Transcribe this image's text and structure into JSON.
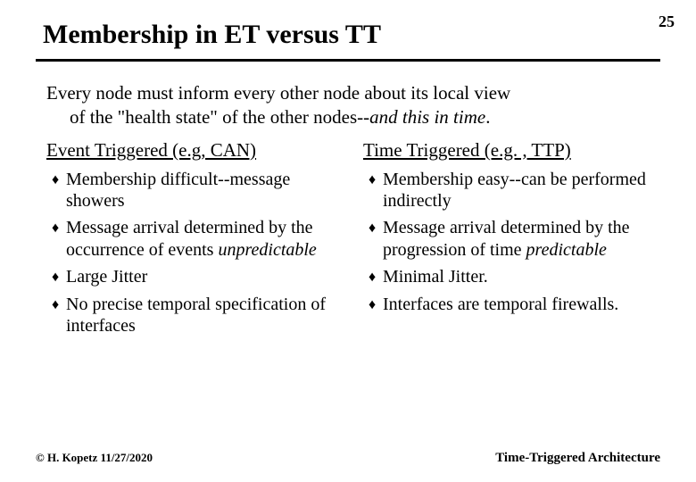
{
  "page_number": "25",
  "title": "Membership in ET versus TT",
  "intro_line1": "Every node must inform every other node about its local view",
  "intro_line2a": "of the \"health state\" of the other nodes--",
  "intro_line2b": "and this in time",
  "intro_line2c": ".",
  "left": {
    "heading": "Event Triggered (e.g, CAN)",
    "items": {
      "a": "Membership difficult--message showers",
      "b1": "Message arrival determined by the occurrence of events",
      "b2": "unpredictable",
      "c": "Large Jitter",
      "d": "No precise temporal specification of interfaces"
    }
  },
  "right": {
    "heading": "Time Triggered (e.g. , TTP)",
    "items": {
      "a": "Membership easy--can be performed indirectly",
      "b1": "Message arrival determined by the progression of time",
      "b2": "predictable",
      "c": "Minimal Jitter.",
      "d": "Interfaces are temporal firewalls."
    }
  },
  "footer_left": "© H. Kopetz  11/27/2020",
  "footer_right": "Time-Triggered Architecture",
  "bullet_glyph": "♦"
}
